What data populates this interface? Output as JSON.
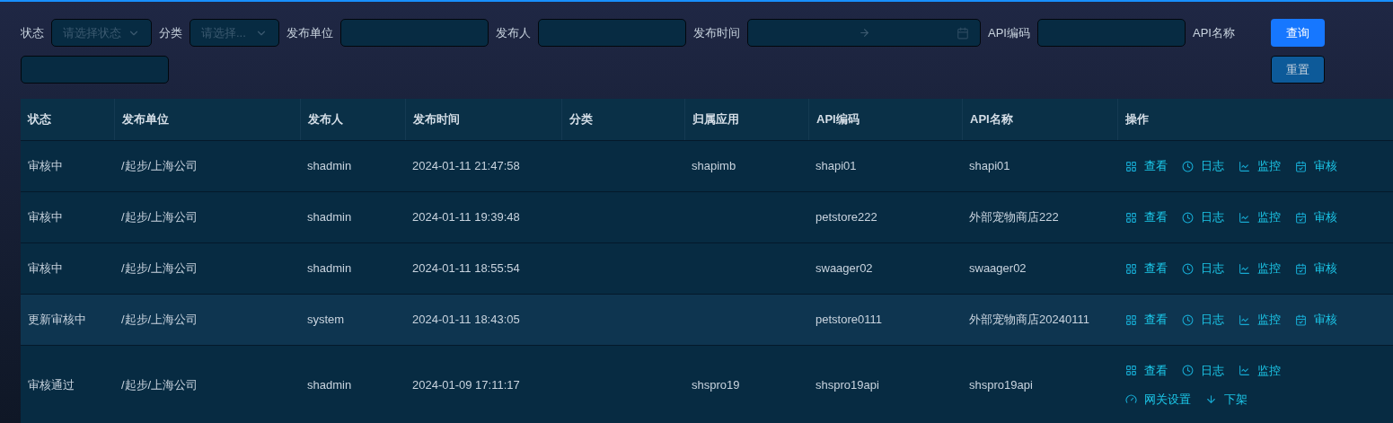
{
  "filters": [
    {
      "kind": "select",
      "label": "状态",
      "placeholder": "请选择状态"
    },
    {
      "kind": "select",
      "label": "分类",
      "placeholder": "请选择..."
    },
    {
      "kind": "input",
      "label": "发布单位"
    },
    {
      "kind": "input",
      "label": "发布人"
    },
    {
      "kind": "daterange",
      "label": "发布时间"
    },
    {
      "kind": "input",
      "label": "API编码"
    },
    {
      "kind": "input",
      "label": "API名称"
    }
  ],
  "buttons": [
    {
      "label": "查询",
      "kind": "primary"
    },
    {
      "label": "重置",
      "kind": "secondary"
    }
  ],
  "table": {
    "columns": [
      "状态",
      "发布单位",
      "发布人",
      "发布时间",
      "分类",
      "归属应用",
      "API编码",
      "API名称",
      "操作"
    ],
    "rows": [
      {
        "selected": false,
        "cells": [
          "审核中",
          "/起步/上海公司",
          "shadmin",
          "2024-01-11 21:47:58",
          "",
          "shapimb",
          "shapi01",
          "shapi01"
        ],
        "actions": [
          {
            "kind": "view",
            "label": "查看"
          },
          {
            "kind": "log",
            "label": "日志"
          },
          {
            "kind": "monitor",
            "label": "监控"
          },
          {
            "kind": "review",
            "label": "审核"
          }
        ]
      },
      {
        "selected": false,
        "cells": [
          "审核中",
          "/起步/上海公司",
          "shadmin",
          "2024-01-11 19:39:48",
          "",
          "",
          "petstore222",
          "外部宠物商店222"
        ],
        "actions": [
          {
            "kind": "view",
            "label": "查看"
          },
          {
            "kind": "log",
            "label": "日志"
          },
          {
            "kind": "monitor",
            "label": "监控"
          },
          {
            "kind": "review",
            "label": "审核"
          }
        ]
      },
      {
        "selected": false,
        "cells": [
          "审核中",
          "/起步/上海公司",
          "shadmin",
          "2024-01-11 18:55:54",
          "",
          "",
          "swaager02",
          "swaager02"
        ],
        "actions": [
          {
            "kind": "view",
            "label": "查看"
          },
          {
            "kind": "log",
            "label": "日志"
          },
          {
            "kind": "monitor",
            "label": "监控"
          },
          {
            "kind": "review",
            "label": "审核"
          }
        ]
      },
      {
        "selected": true,
        "cells": [
          "更新审核中",
          "/起步/上海公司",
          "system",
          "2024-01-11 18:43:05",
          "",
          "",
          "petstore0111",
          "外部宠物商店20240111"
        ],
        "actions": [
          {
            "kind": "view",
            "label": "查看"
          },
          {
            "kind": "log",
            "label": "日志"
          },
          {
            "kind": "monitor",
            "label": "监控"
          },
          {
            "kind": "review",
            "label": "审核"
          }
        ]
      },
      {
        "selected": false,
        "cells": [
          "审核通过",
          "/起步/上海公司",
          "shadmin",
          "2024-01-09 17:11:17",
          "",
          "shspro19",
          "shspro19api",
          "shspro19api"
        ],
        "actions": [
          {
            "kind": "view",
            "label": "查看"
          },
          {
            "kind": "log",
            "label": "日志"
          },
          {
            "kind": "monitor",
            "label": "监控"
          },
          {
            "kind": "gateway",
            "label": "网关设置"
          },
          {
            "kind": "offline",
            "label": "下架"
          }
        ]
      }
    ]
  }
}
